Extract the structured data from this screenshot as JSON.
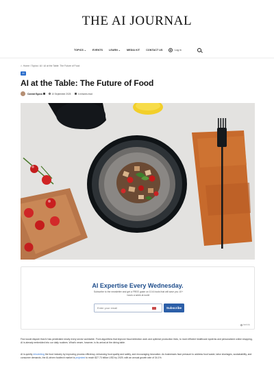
{
  "site": {
    "logo": "THE AI JOURNAL"
  },
  "nav": {
    "items": [
      {
        "label": "TOPICS",
        "chevron": "⌄"
      },
      {
        "label": "EVENTS"
      },
      {
        "label": "LEARN",
        "chevron": "⌄"
      },
      {
        "label": "MEDIA KIT"
      },
      {
        "label": "CONTACT US"
      }
    ],
    "login_label": "Log in"
  },
  "breadcrumb": "Home / Topics / AI / AI at the Table: The Future of Food",
  "article": {
    "category": "AI",
    "title": "AI at the Table: The Future of Food",
    "author": "Conrad Egusa",
    "date": "10 September 2025",
    "read_time": "4 minutes read"
  },
  "newsletter": {
    "heading": "AI Expertise Every Wednesday.",
    "description": "Subscribe to the newsletter and get a FREE guide on 10 AI tools that will save you 10+ hours a week at work!",
    "email_placeholder": "Enter your email",
    "subscribe_label": "Subscribe",
    "powered_by": "beehiiv"
  },
  "body": {
    "p1": "Few would dispute that AI has penetrated nearly every sector worldwide. From algorithms that improve fraud detection work and optimize production lines, to more efficient healthcare systems and personalized online shopping, AI is already embedded into our daily routines. What’s newer, however, is its arrival at the dining table.",
    "p2_a": "AI is quietly ",
    "p2_link1": "reinventing",
    "p2_b": " the food industry by improving process efficiency, enhancing food quality and safety, and encouraging innovation. As businesses face pressure to address food waste, labor shortages, sustainability, and consumer demands, the AI-driven foodtech market is ",
    "p2_link2": "projected",
    "p2_c": " to reach $27.73 billion USD by 2029, with an annual growth rate of 34.1%."
  },
  "colors": {
    "accent": "#2c6ecb",
    "newsletter_heading": "#1f4e8c",
    "subscribe_button": "#2c5fa8"
  }
}
